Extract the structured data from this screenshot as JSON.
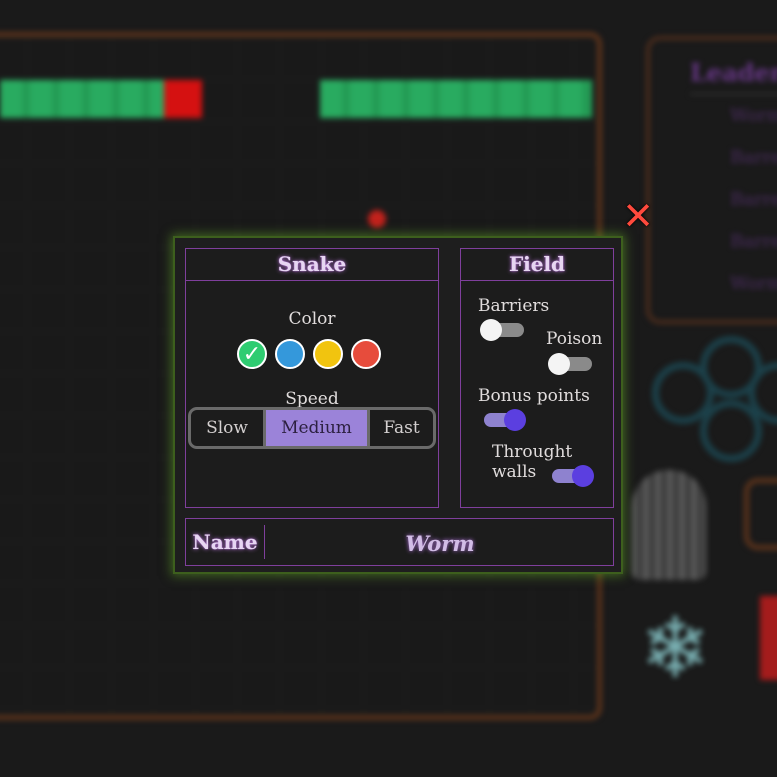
{
  "background": {
    "leaderboard_title": "Leaderb",
    "leaderboard_rows": [
      "Wormm",
      "Barren",
      "Barren",
      "Barren",
      "Wormm"
    ]
  },
  "dialog": {
    "close_icon": "close-x-icon",
    "snake": {
      "title": "Snake",
      "color_label": "Color",
      "colors": [
        "#2ecc71",
        "#3498db",
        "#f1c40f",
        "#e74c3c"
      ],
      "selected_color_index": 0,
      "speed_label": "Speed",
      "speeds": [
        "Slow",
        "Medium",
        "Fast"
      ],
      "selected_speed": "Medium"
    },
    "field": {
      "title": "Field",
      "barriers_label": "Barriers",
      "barriers_on": false,
      "poison_label": "Poison",
      "poison_on": false,
      "bonus_label": "Bonus points",
      "bonus_on": true,
      "walls_label": "Throught walls",
      "walls_on": true
    },
    "name": {
      "label": "Name",
      "value": "Worm"
    }
  }
}
